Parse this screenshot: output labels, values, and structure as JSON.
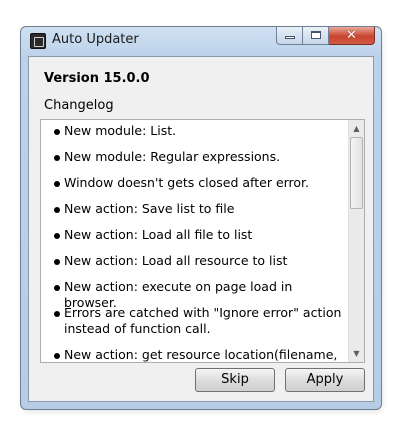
{
  "window": {
    "title": "Auto Updater",
    "icon": "app-icon",
    "caption_buttons": {
      "minimize": "minimize-icon",
      "maximize": "maximize-icon",
      "close_glyph": "✕"
    }
  },
  "header": {
    "version": "Version 15.0.0",
    "changelog_label": "Changelog"
  },
  "changelog": {
    "items": [
      "New module: List.",
      "New module: Regular expressions.",
      "Window doesn't gets closed after error.",
      "New action: Save list to file",
      "New action: Load all file to list",
      "New action: Load all resource to list",
      "New action: execute on page load in browser.",
      "Errors are catched with \"Ignore error\" action instead of function call.",
      "New action: get resource location(filename,"
    ]
  },
  "buttons": {
    "skip": "Skip",
    "apply": "Apply"
  },
  "colors": {
    "titlebar": "#bcd2ea",
    "close_button": "#c8442e",
    "client_bg": "#f0f0f0"
  }
}
